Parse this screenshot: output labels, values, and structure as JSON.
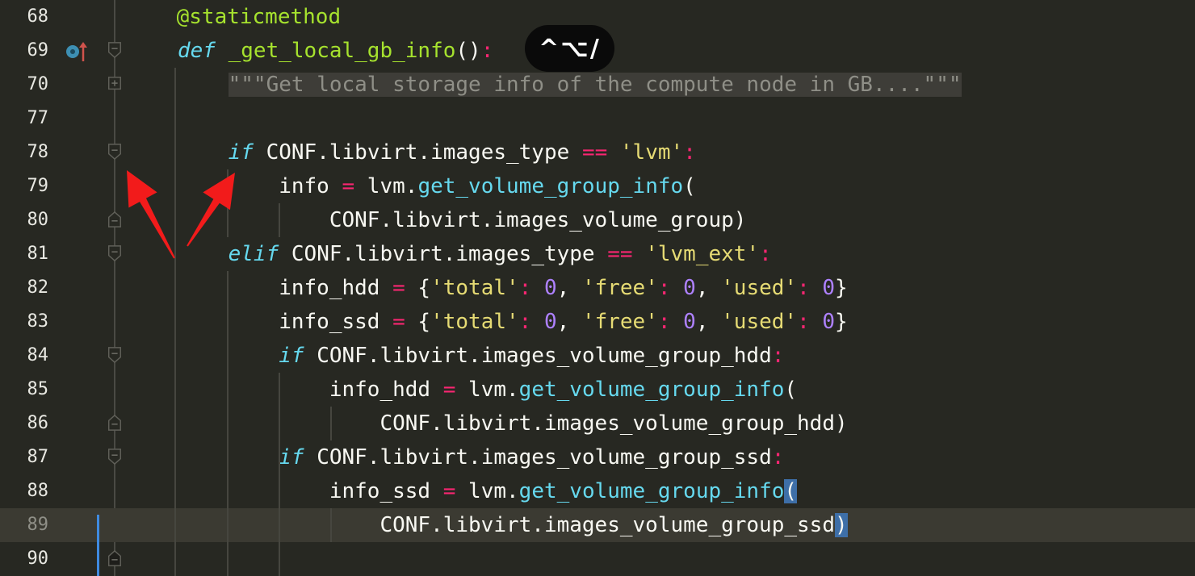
{
  "editor": {
    "current_line": 89,
    "lines": [
      {
        "number": "68",
        "tokens": [
          [
            "deco",
            "    @staticmethod"
          ]
        ]
      },
      {
        "number": "69",
        "tokens": [
          [
            "kw",
            "def"
          ],
          [
            "",
            "  "
          ],
          [
            "fn",
            "_get_local_gb_info"
          ],
          [
            "",
            "()"
          ],
          [
            "op",
            ":"
          ]
        ]
      },
      {
        "number": "70",
        "tokens": [
          [
            "",
            "    "
          ],
          [
            "doc",
            "\"\"\"Get local storage info of the compute node in GB....\"\"\""
          ]
        ]
      },
      {
        "number": "77",
        "tokens": []
      },
      {
        "number": "78",
        "tokens": [
          [
            "",
            "    "
          ],
          [
            "kw",
            "if"
          ],
          [
            "",
            " CONF.libvirt.images_type "
          ],
          [
            "op",
            "=="
          ],
          [
            "",
            " "
          ],
          [
            "str",
            "'lvm'"
          ],
          [
            "op",
            ":"
          ]
        ]
      },
      {
        "number": "79",
        "tokens": [
          [
            "",
            "        info "
          ],
          [
            "op",
            "="
          ],
          [
            "",
            " lvm."
          ],
          [
            "call",
            "get_volume_group_info"
          ],
          [
            "",
            "("
          ]
        ]
      },
      {
        "number": "80",
        "tokens": [
          [
            "",
            "            CONF.libvirt.images_volume_group)"
          ]
        ]
      },
      {
        "number": "81",
        "tokens": [
          [
            "",
            "    "
          ],
          [
            "kw",
            "elif"
          ],
          [
            "",
            " CONF.libvirt.images_type "
          ],
          [
            "op",
            "=="
          ],
          [
            "",
            " "
          ],
          [
            "str",
            "'lvm_ext'"
          ],
          [
            "op",
            ":"
          ]
        ]
      },
      {
        "number": "82",
        "tokens": [
          [
            "",
            "        info_hdd "
          ],
          [
            "op",
            "="
          ],
          [
            "",
            " {"
          ],
          [
            "str",
            "'total'"
          ],
          [
            "op",
            ":"
          ],
          [
            "",
            " "
          ],
          [
            "num",
            "0"
          ],
          [
            "",
            ", "
          ],
          [
            "str",
            "'free'"
          ],
          [
            "op",
            ":"
          ],
          [
            "",
            " "
          ],
          [
            "num",
            "0"
          ],
          [
            "",
            ", "
          ],
          [
            "str",
            "'used'"
          ],
          [
            "op",
            ":"
          ],
          [
            "",
            " "
          ],
          [
            "num",
            "0"
          ],
          [
            "",
            "}"
          ]
        ]
      },
      {
        "number": "83",
        "tokens": [
          [
            "",
            "        info_ssd "
          ],
          [
            "op",
            "="
          ],
          [
            "",
            " {"
          ],
          [
            "str",
            "'total'"
          ],
          [
            "op",
            ":"
          ],
          [
            "",
            " "
          ],
          [
            "num",
            "0"
          ],
          [
            "",
            ", "
          ],
          [
            "str",
            "'free'"
          ],
          [
            "op",
            ":"
          ],
          [
            "",
            " "
          ],
          [
            "num",
            "0"
          ],
          [
            "",
            ", "
          ],
          [
            "str",
            "'used'"
          ],
          [
            "op",
            ":"
          ],
          [
            "",
            " "
          ],
          [
            "num",
            "0"
          ],
          [
            "",
            "}"
          ]
        ]
      },
      {
        "number": "84",
        "tokens": [
          [
            "",
            "        "
          ],
          [
            "kw",
            "if"
          ],
          [
            "",
            " CONF.libvirt.images_volume_group_hdd"
          ],
          [
            "op",
            ":"
          ]
        ]
      },
      {
        "number": "85",
        "tokens": [
          [
            "",
            "            info_hdd "
          ],
          [
            "op",
            "="
          ],
          [
            "",
            " lvm."
          ],
          [
            "call",
            "get_volume_group_info"
          ],
          [
            "",
            "("
          ]
        ]
      },
      {
        "number": "86",
        "tokens": [
          [
            "",
            "                CONF.libvirt.images_volume_group_hdd)"
          ]
        ]
      },
      {
        "number": "87",
        "tokens": [
          [
            "",
            "        "
          ],
          [
            "kw",
            "if"
          ],
          [
            "",
            " CONF.libvirt.images_volume_group_ssd"
          ],
          [
            "op",
            ":"
          ]
        ]
      },
      {
        "number": "88",
        "tokens": [
          [
            "",
            "            info_ssd "
          ],
          [
            "op",
            "="
          ],
          [
            "",
            " lvm."
          ],
          [
            "call",
            "get_volume_group_info"
          ],
          [
            "brace-match",
            "("
          ]
        ]
      },
      {
        "number": "89",
        "tokens": [
          [
            "",
            "                CONF.libvirt.images_volume_group_ssd"
          ],
          [
            "brace-match",
            ")"
          ]
        ]
      },
      {
        "number": "90",
        "tokens": []
      }
    ]
  },
  "shortcut_hint": {
    "label": "^⌥/"
  },
  "gutter": {
    "line_69_icons": [
      "implements-icon",
      "overrides-up-arrow-icon"
    ]
  },
  "colors": {
    "background": "#272822",
    "current_line": "#3b3a32",
    "keyword": "#66d9ef",
    "function_name": "#a6e22e",
    "operator": "#f92672",
    "string": "#e6db74",
    "number": "#ae81ff",
    "docstring": "#8f8f87",
    "brace_match": "#3e6fa8",
    "annotation_arrow": "#f21b1b"
  }
}
